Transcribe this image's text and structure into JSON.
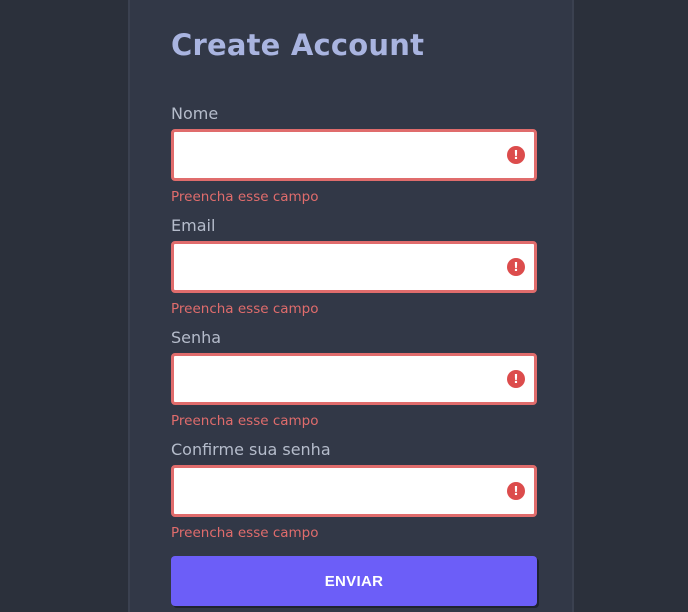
{
  "form": {
    "title": "Create Account",
    "fields": [
      {
        "label": "Nome",
        "value": "",
        "error": "Preencha esse campo"
      },
      {
        "label": "Email",
        "value": "",
        "error": "Preencha esse campo"
      },
      {
        "label": "Senha",
        "value": "",
        "error": "Preencha esse campo"
      },
      {
        "label": "Confirme sua senha",
        "value": "",
        "error": "Preencha esse campo"
      }
    ],
    "error_icon_glyph": "!",
    "submit_label": "ENVIAR"
  },
  "colors": {
    "background": "#2b303b",
    "card": "#323847",
    "title": "#a9b4e0",
    "label": "#b5bccb",
    "error": "#e06c6c",
    "error_icon": "#dc4c4c",
    "button": "#6c5ef8"
  },
  "icons": [
    "exclamation-circle-icon"
  ]
}
